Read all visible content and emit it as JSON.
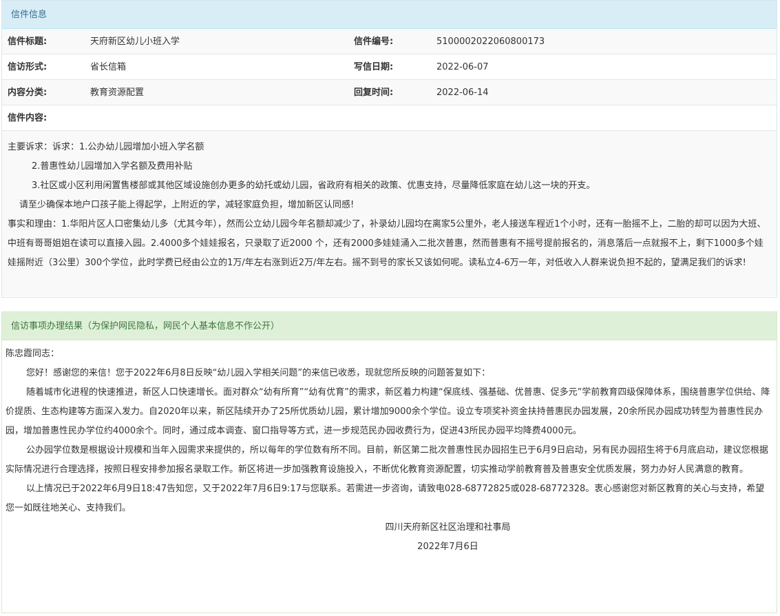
{
  "info_panel": {
    "header": "信件信息",
    "title_label": "信件标题:",
    "title_value": "天府新区幼儿小班入学",
    "number_label": "信件编号:",
    "number_value": "5100002022060800173",
    "form_label": "信访形式:",
    "form_value": "省长信箱",
    "date_label": "写信日期:",
    "date_value": "2022-06-07",
    "category_label": "内容分类:",
    "category_value": "教育资源配置",
    "reply_label": "回复时间:",
    "reply_value": "2022-06-14",
    "content_label": "信件内容:",
    "content": [
      "主要诉求：诉求：1.公办幼儿园增加小班入学名额",
      "2.普惠性幼儿园增加入学名额及费用补贴",
      "3.社区或小区利用闲置售楼部或其他区域设施创办更多的幼托或幼儿园，省政府有相关的政策、优惠支持，尽量降低家庭在幼儿这一块的开支。",
      "请至少确保本地户口孩子能上得起学，上附近的学，减轻家庭负担，增加新区认同感!",
      "事实和理由：1.华阳片区人口密集幼儿多（尤其今年），然而公立幼儿园今年名额却减少了，补录幼儿园均在离家5公里外，老人接送车程近1个小时，还有一胎摇不上，二胎的却可以因为大班、中班有哥哥姐姐在读可以直接入园。2.4000多个娃娃报名，只录取了近2000 个，还有2000多娃娃涌入二批次普惠，然而普惠有不摇号提前报名的，消息落后一点就报不上，剩下1000多个娃娃摇附近（3公里）300个学位，此时学费已经由公立的1万/年左右涨到近2万/年左右。摇不到号的家长又该如何呢。读私立4-6万一年，对低收入人群来说负担不起的，望满足我们的诉求!"
    ]
  },
  "result_panel": {
    "header": "信访事项办理结果（为保护网民隐私，网民个人基本信息不作公开）",
    "greeting": "陈忠霞同志：",
    "paragraphs": [
      "您好！感谢您的来信！您于2022年6月8日反映“幼儿园入学相关问题”的来信已收悉，现就您所反映的问题答复如下：",
      "随着城市化进程的快速推进，新区人口快速增长。面对群众“幼有所育”“幼有优育”的需求，新区着力构建“保底线、强基础、优普惠、促多元”学前教育四级保障体系，围绕普惠学位供给、降价提质、生态构建等方面深入发力。自2020年以来，新区陆续开办了25所优质幼儿园，累计增加9000余个学位。设立专项奖补资金扶持普惠民办园发展，20余所民办园成功转型为普惠性民办园，增加普惠性民办学位约4000余个。同时，通过成本调查、窗口指导等方式，进一步规范民办园收费行为，促进43所民办园平均降费4000元。",
      "公办园学位数是根据设计规模和当年入园需求来提供的，所以每年的学位数有所不同。目前，新区第二批次普惠性民办园招生已于6月9日启动，另有民办园招生将于6月底启动，建议您根据实际情况进行合理选择，按照日程安排参加报名录取工作。新区将进一步加强教育设施投入，不断优化教育资源配置，切实推动学前教育普及普惠安全优质发展，努力办好人民满意的教育。",
      "以上情况已于2022年6月9日18:47告知您，又于2022年7月6日9:17与您联系。若需进一步咨询，请致电028-68772825或028-68772328。衷心感谢您对新区教育的关心与支持，希望您一如既往地关心、支持我们。"
    ],
    "signature": "四川天府新区社区治理和社事局",
    "sign_date": "2022年7月6日"
  }
}
